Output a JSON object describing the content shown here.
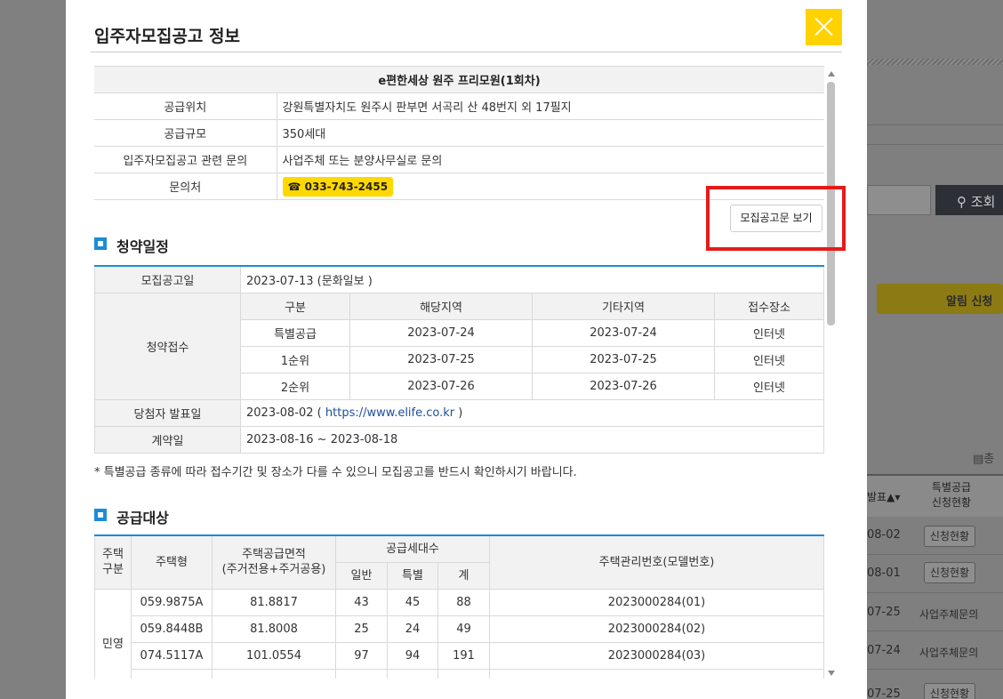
{
  "background": {
    "search_label": "조회",
    "alarm_label": "알림 신청",
    "total_label": "총",
    "col_announce": "발표",
    "col_special": "특별공급 신청현황",
    "rows": [
      {
        "date": "08-02",
        "status": "신청현황",
        "type": "button"
      },
      {
        "date": "08-01",
        "status": "신청현황",
        "type": "button"
      },
      {
        "date": "07-25",
        "status": "사업주체문의",
        "type": "text"
      },
      {
        "date": "07-24",
        "status": "사업주체문의",
        "type": "text"
      },
      {
        "date": "07-25",
        "status": "신청현황",
        "type": "button"
      }
    ]
  },
  "modal": {
    "title": "입주자모집공고 정보",
    "close_label": "X",
    "notice_button": "모집공고문 보기",
    "info": {
      "name": "e편한세상 원주 프리모원(1회차)",
      "rows": [
        {
          "label": "공급위치",
          "value": "강원특별자치도 원주시 판부면 서곡리 산 48번지 외 17필지"
        },
        {
          "label": "공급규모",
          "value": "350세대"
        },
        {
          "label": "입주자모집공고 관련 문의",
          "value": "사업주체 또는 분양사무실로 문의"
        }
      ],
      "contact_label": "문의처",
      "contact_phone": "☎ 033-743-2455"
    },
    "schedule": {
      "section_title": "청약일정",
      "announce_label": "모집공고일",
      "announce_value": "2023-07-13 (문화일보 )",
      "receipt_label": "청약접수",
      "receipt_headers": [
        "구분",
        "해당지역",
        "기타지역",
        "접수장소"
      ],
      "receipt_rows": [
        [
          "특별공급",
          "2023-07-24",
          "2023-07-24",
          "인터넷"
        ],
        [
          "1순위",
          "2023-07-25",
          "2023-07-25",
          "인터넷"
        ],
        [
          "2순위",
          "2023-07-26",
          "2023-07-26",
          "인터넷"
        ]
      ],
      "winner_label": "당첨자 발표일",
      "winner_date": "2023-08-02 ( ",
      "winner_link": "https://www.elife.co.kr",
      "winner_tail": " )",
      "contract_label": "계약일",
      "contract_value": "2023-08-16 ~ 2023-08-18",
      "note": "* 특별공급 종류에 따라 접수기간 및 장소가 다를 수 있으니 모집공고를 반드시 확인하시기 바랍니다."
    },
    "supply": {
      "section_title": "공급대상",
      "headers": {
        "house_div": "주택\n구분",
        "house_type": "주택형",
        "area": "주택공급면적\n(주거전용+주거공용)",
        "units": "공급세대수",
        "general": "일반",
        "special": "특별",
        "total": "계",
        "mgmt_no": "주택관리번호(모델번호)"
      },
      "group": "민영",
      "rows": [
        {
          "type": "059.9875A",
          "area": "81.8817",
          "general": "43",
          "special": "45",
          "total": "88",
          "no": "2023000284(01)"
        },
        {
          "type": "059.8448B",
          "area": "81.8008",
          "general": "25",
          "special": "24",
          "total": "49",
          "no": "2023000284(02)"
        },
        {
          "type": "074.5117A",
          "area": "101.0554",
          "general": "97",
          "special": "94",
          "total": "191",
          "no": "2023000284(03)"
        }
      ]
    }
  }
}
